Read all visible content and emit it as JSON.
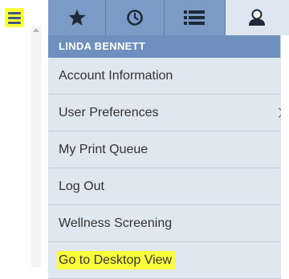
{
  "sidebar": {
    "menu_toggle_icon": "hamburger-icon",
    "highlight_color": "#ffff3a"
  },
  "toolbar": {
    "buttons": [
      {
        "name": "favorites",
        "icon": "star-icon"
      },
      {
        "name": "history",
        "icon": "clock-icon"
      },
      {
        "name": "list",
        "icon": "list-icon"
      },
      {
        "name": "user",
        "icon": "user-icon",
        "active": true
      }
    ],
    "color": "#7b9ac6"
  },
  "user_menu": {
    "user_name": "LINDA BENNETT",
    "items": [
      {
        "label": "Account Information"
      },
      {
        "label": "User Preferences",
        "has_submenu": true
      },
      {
        "label": "My Print Queue"
      },
      {
        "label": "Log Out"
      },
      {
        "label": "Wellness Screening"
      },
      {
        "label": "Go to Desktop View",
        "highlighted": true
      }
    ]
  }
}
